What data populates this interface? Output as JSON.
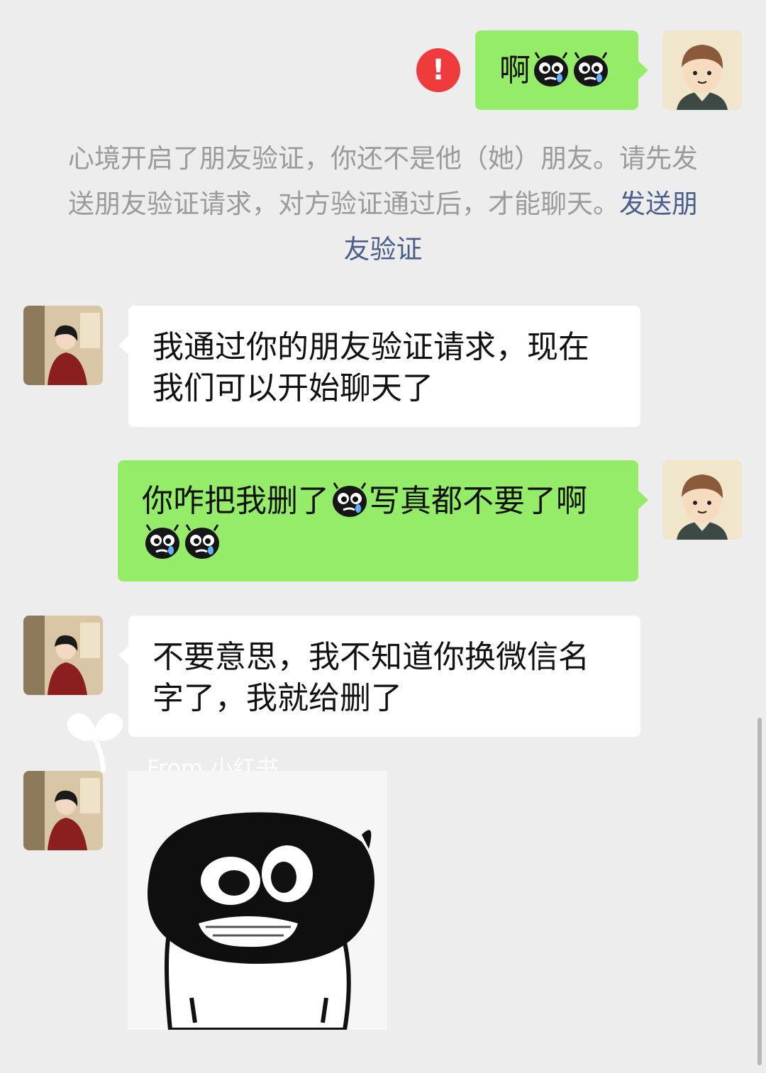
{
  "messages": [
    {
      "id": "m1",
      "side": "right",
      "text": "啊",
      "emoji_count": 2,
      "status": "failed"
    },
    {
      "id": "m2",
      "side": "left",
      "line1": "我通过你的朋友验证请求，现在",
      "line2": "我们可以开始聊天了"
    },
    {
      "id": "m3",
      "side": "right",
      "line1a": "你咋把我删了",
      "line1b": "写真都不要了啊",
      "emoji_count": 3
    },
    {
      "id": "m4",
      "side": "left",
      "line1": "不要意思，我不知道你换微信名",
      "line2": "字了，我就给删了"
    },
    {
      "id": "m5",
      "side": "left",
      "type": "sticker"
    }
  ],
  "system_notice": {
    "text": "心境开启了朋友验证，你还不是他（她）朋友。请先发送朋友验证请求，对方验证通过后，才能聊天。",
    "link": "发送朋友验证"
  },
  "alert_icon": "!",
  "watermark": "From 小红书",
  "emoji_icon": "crying-black-bug-emoji",
  "colors": {
    "green_bubble": "#95ec69",
    "white_bubble": "#ffffff",
    "background": "#ededed",
    "link": "#4a5f8c",
    "alert": "#ef3b3b"
  }
}
